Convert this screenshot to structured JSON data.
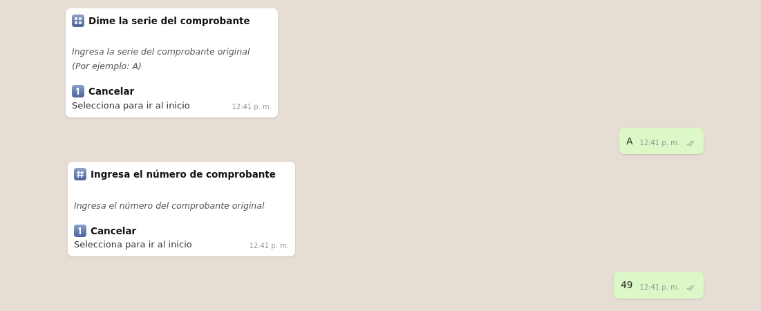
{
  "messages": [
    {
      "kind": "prompt",
      "title": "Dime la serie del comprobante",
      "body_lines": [
        "Ingresa la serie del comprobante original",
        "(Por ejemplo: A)"
      ],
      "option_label": "Cancelar",
      "option_hint": "Selecciona para ir al inicio",
      "time": "12:41 p. m."
    },
    {
      "kind": "reply",
      "text": "A",
      "time": "12:41 p. m."
    },
    {
      "kind": "prompt",
      "title": "Ingresa el número de comprobante",
      "body_lines": [
        "Ingresa el número del comprobante original"
      ],
      "option_label": "Cancelar",
      "option_hint": "Selecciona para ir al inicio",
      "time": "12:41 p. m."
    },
    {
      "kind": "reply",
      "text": "49",
      "time": "12:41 p. m."
    }
  ]
}
